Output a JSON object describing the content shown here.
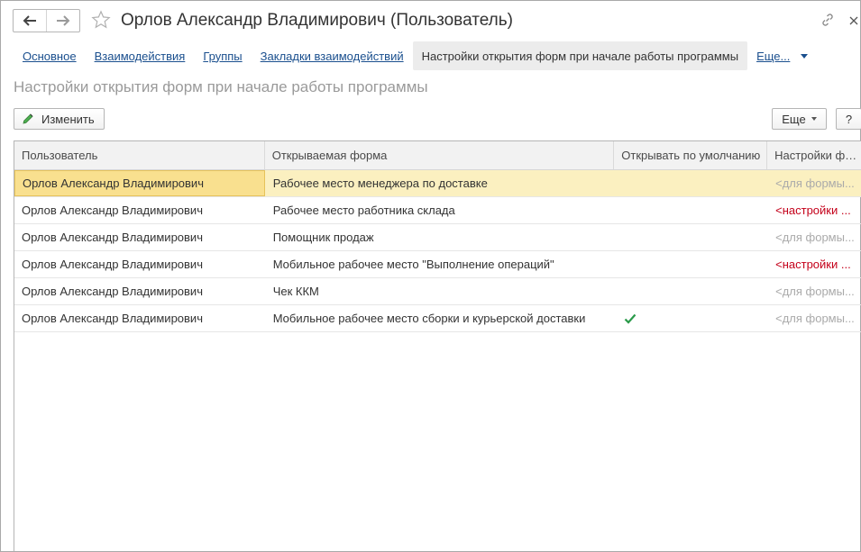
{
  "header": {
    "title": "Орлов Александр Владимирович (Пользователь)",
    "back_icon": "arrow-left-icon",
    "forward_icon": "arrow-right-icon",
    "favorite_icon": "star-icon",
    "link_icon": "link-icon",
    "close_icon": "close-icon"
  },
  "tabs": [
    {
      "label": "Основное",
      "active": false
    },
    {
      "label": "Взаимодействия",
      "active": false
    },
    {
      "label": "Группы",
      "active": false
    },
    {
      "label": "Закладки взаимодействий",
      "active": false
    },
    {
      "label": "Настройки открытия форм при начале работы программы",
      "active": true
    },
    {
      "label": "Еще...",
      "active": false
    }
  ],
  "section_title": "Настройки открытия форм при начале работы программы",
  "toolbar": {
    "edit_label": "Изменить",
    "more_label": "Еще",
    "help_label": "?"
  },
  "table": {
    "columns": [
      "Пользователь",
      "Открываемая форма",
      "Открывать по умолчанию",
      "Настройки формы"
    ],
    "rows": [
      {
        "user": "Орлов Александр Владимирович",
        "form": "Рабочее место менеджера по доставке",
        "default": false,
        "settings": "<для формы...",
        "settings_style": "grey",
        "selected": true
      },
      {
        "user": "Орлов Александр Владимирович",
        "form": "Рабочее место работника склада",
        "default": false,
        "settings": "<настройки ...",
        "settings_style": "red",
        "selected": false
      },
      {
        "user": "Орлов Александр Владимирович",
        "form": "Помощник продаж",
        "default": false,
        "settings": "<для формы...",
        "settings_style": "grey",
        "selected": false
      },
      {
        "user": "Орлов Александр Владимирович",
        "form": "Мобильное рабочее место \"Выполнение операций\"",
        "default": false,
        "settings": "<настройки ...",
        "settings_style": "red",
        "selected": false
      },
      {
        "user": "Орлов Александр Владимирович",
        "form": "Чек ККМ",
        "default": false,
        "settings": "<для формы...",
        "settings_style": "grey",
        "selected": false
      },
      {
        "user": "Орлов Александр Владимирович",
        "form": "Мобильное рабочее место сборки и курьерской доставки",
        "default": true,
        "settings": "<для формы...",
        "settings_style": "grey",
        "selected": false
      }
    ]
  },
  "colors": {
    "link": "#1a4f8e",
    "selected_row": "#fbf0c0",
    "selected_cell": "#f9e08f",
    "check": "#2a9a4a",
    "warning_text": "#c4001a"
  }
}
